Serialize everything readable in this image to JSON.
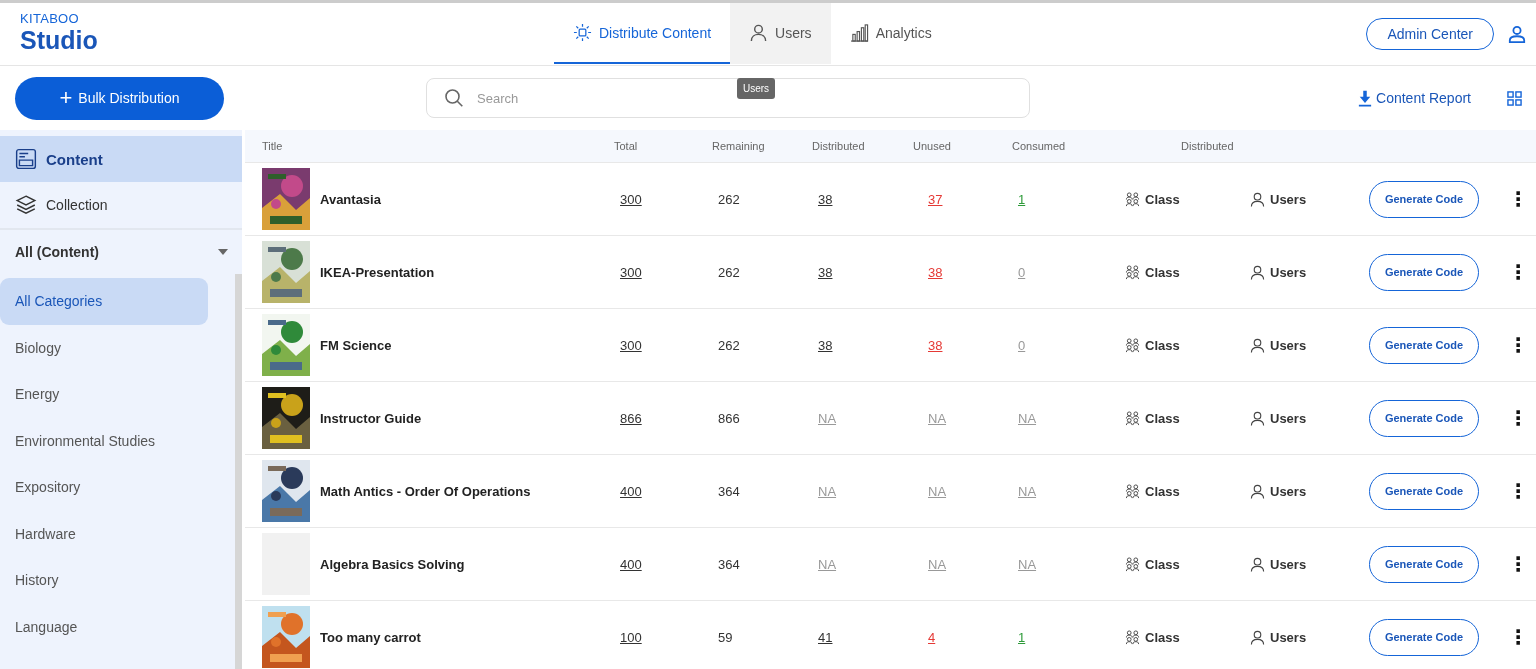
{
  "logo": {
    "brand": "KITABOO",
    "product": "Studio"
  },
  "tabs": [
    {
      "label": "Distribute Content",
      "selected": true,
      "hovered": false
    },
    {
      "label": "Users",
      "selected": false,
      "hovered": true
    },
    {
      "label": "Analytics",
      "selected": false,
      "hovered": false
    }
  ],
  "tooltip": "Users",
  "admin_button": "Admin Center",
  "bulk_button": {
    "icon": "+",
    "label": "Bulk Distribution"
  },
  "search": {
    "placeholder": "Search"
  },
  "content_report": "Content Report",
  "sidebar": {
    "items": [
      {
        "label": "Content",
        "selected": true
      },
      {
        "label": "Collection",
        "selected": false
      }
    ],
    "filter": "All (Content)",
    "categories": [
      {
        "label": "All Categories",
        "selected": true
      },
      {
        "label": "Biology",
        "selected": false
      },
      {
        "label": "Energy",
        "selected": false
      },
      {
        "label": "Environmental Studies",
        "selected": false
      },
      {
        "label": "Expository",
        "selected": false
      },
      {
        "label": "Hardware",
        "selected": false
      },
      {
        "label": "History",
        "selected": false
      },
      {
        "label": "Language",
        "selected": false
      }
    ]
  },
  "table": {
    "columns": [
      "Title",
      "Total",
      "Remaining",
      "Distributed",
      "Unused",
      "Consumed",
      "Distributed"
    ],
    "rows": [
      {
        "title": "Avantasia",
        "numbers": [
          {
            "text": "300",
            "kind": "link"
          },
          {
            "text": "262",
            "kind": "plain"
          },
          {
            "text": "38",
            "kind": "link"
          },
          {
            "text": "37",
            "kind": "alert"
          },
          {
            "text": "1",
            "kind": "ok"
          }
        ],
        "class": "Class",
        "users": "Users",
        "button": "Generate Code",
        "menu": "⋮"
      },
      {
        "title": "IKEA-Presentation",
        "numbers": [
          {
            "text": "300",
            "kind": "link"
          },
          {
            "text": "262",
            "kind": "plain"
          },
          {
            "text": "38",
            "kind": "link"
          },
          {
            "text": "38",
            "kind": "alert"
          },
          {
            "text": "0",
            "kind": "muted"
          }
        ],
        "class": "Class",
        "users": "Users",
        "button": "Generate Code",
        "menu": "⋮"
      },
      {
        "title": "FM Science",
        "numbers": [
          {
            "text": "300",
            "kind": "link"
          },
          {
            "text": "262",
            "kind": "plain"
          },
          {
            "text": "38",
            "kind": "link"
          },
          {
            "text": "38",
            "kind": "alert"
          },
          {
            "text": "0",
            "kind": "muted"
          }
        ],
        "class": "Class",
        "users": "Users",
        "button": "Generate Code",
        "menu": "⋮"
      },
      {
        "title": "Instructor Guide",
        "numbers": [
          {
            "text": "866",
            "kind": "link"
          },
          {
            "text": "866",
            "kind": "plain"
          },
          {
            "text": "NA",
            "kind": "muted"
          },
          {
            "text": "NA",
            "kind": "muted"
          },
          {
            "text": "NA",
            "kind": "muted"
          }
        ],
        "class": "Class",
        "users": "Users",
        "button": "Generate Code",
        "menu": "⋮"
      },
      {
        "title": "Math Antics - Order Of Operations",
        "numbers": [
          {
            "text": "400",
            "kind": "link"
          },
          {
            "text": "364",
            "kind": "plain"
          },
          {
            "text": "NA",
            "kind": "muted"
          },
          {
            "text": "NA",
            "kind": "muted"
          },
          {
            "text": "NA",
            "kind": "muted"
          }
        ],
        "class": "Class",
        "users": "Users",
        "button": "Generate Code",
        "menu": "⋮"
      },
      {
        "cover": {
          "kind": "blank"
        },
        "title": "Algebra Basics Solving",
        "numbers": [
          {
            "text": "400",
            "kind": "link"
          },
          {
            "text": "364",
            "kind": "plain"
          },
          {
            "text": "NA",
            "kind": "muted"
          },
          {
            "text": "NA",
            "kind": "muted"
          },
          {
            "text": "NA",
            "kind": "muted"
          }
        ],
        "class": "Class",
        "users": "Users",
        "button": "Generate Code",
        "menu": "⋮"
      },
      {
        "title": "Too many carrot",
        "numbers": [
          {
            "text": "100",
            "kind": "link"
          },
          {
            "text": "59",
            "kind": "plain"
          },
          {
            "text": "41",
            "kind": "link"
          },
          {
            "text": "4",
            "kind": "alert"
          },
          {
            "text": "1",
            "kind": "ok"
          }
        ],
        "class": "Class",
        "users": "Users",
        "button": "Generate Code",
        "menu": "⋮"
      }
    ]
  }
}
